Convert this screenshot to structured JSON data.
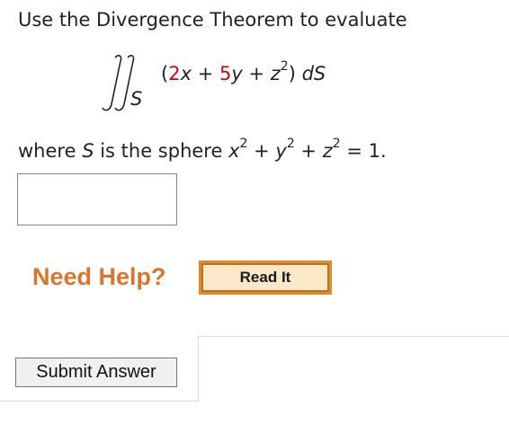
{
  "prompt": "Use the Divergence Theorem to evaluate",
  "integral": {
    "surface_subscript": "S",
    "open_paren": "(",
    "coef_x": "2",
    "var_x": "x",
    "plus1": " + ",
    "coef_y": "5",
    "var_y": "y",
    "plus2": " + ",
    "var_z": "z",
    "exp_z": "2",
    "close_paren": ")",
    "measure": "dS"
  },
  "condition": {
    "text_before": "where ",
    "surface": "S",
    "text_mid": " is the sphere ",
    "x": "x",
    "x_exp": "2",
    "plus1": " + ",
    "y": "y",
    "y_exp": "2",
    "plus2": " + ",
    "z": "z",
    "z_exp": "2",
    "equals": " = 1."
  },
  "answer_input": {
    "value": "",
    "placeholder": ""
  },
  "help": {
    "label": "Need Help?",
    "read_it_label": "Read It"
  },
  "submit": {
    "label": "Submit Answer"
  },
  "colors": {
    "coefficient_red": "#d0021b",
    "help_orange": "#d9762b",
    "read_button_border": "#e08a2c",
    "read_button_fill": "#fbe8c9"
  }
}
